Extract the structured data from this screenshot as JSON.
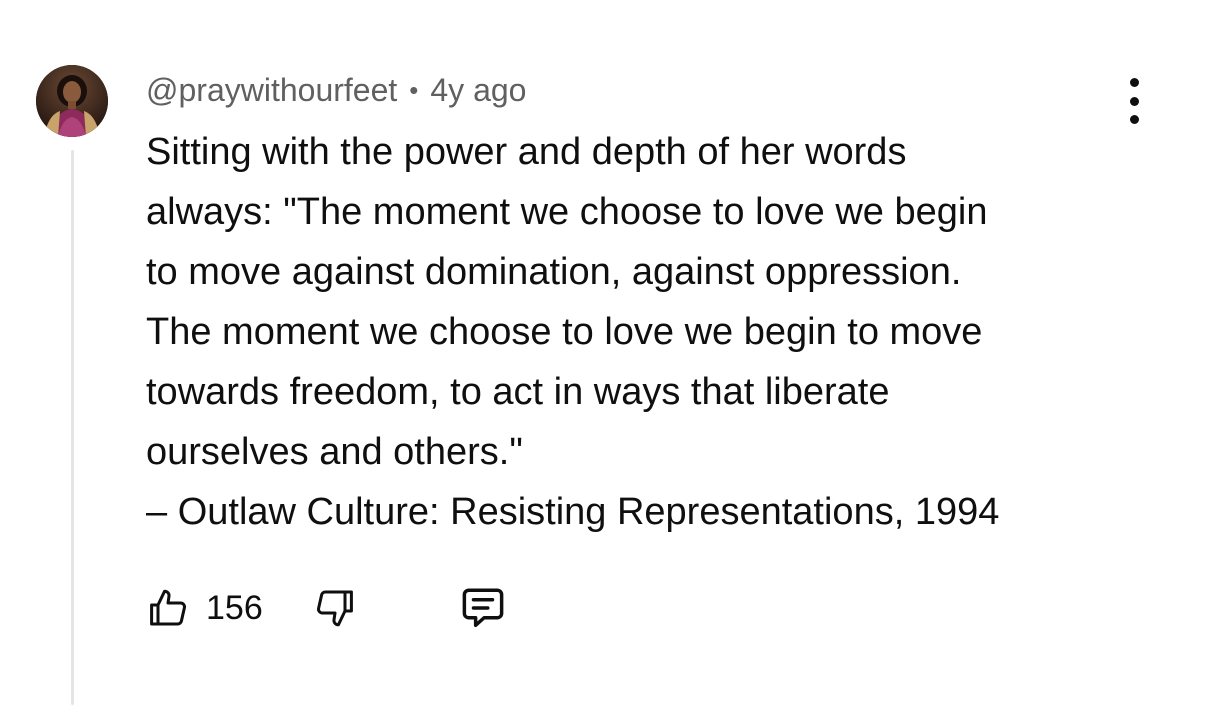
{
  "comment": {
    "handle": "@praywithourfeet",
    "separator": "•",
    "time_ago": "4y ago",
    "body_lines": [
      "Sitting with the power and depth of her words",
      "always: \"The moment we choose to love we begin",
      "to move against domination, against oppression.",
      "The moment we choose to love we begin to move",
      "towards freedom, to act in ways that liberate",
      "ourselves and others.\"",
      "– Outlaw Culture: Resisting Representations, 1994"
    ],
    "like_count": "156"
  },
  "icons": {
    "more": "more-vertical-icon",
    "like": "thumbs-up-icon",
    "dislike": "thumbs-down-icon",
    "reply": "comment-reply-icon"
  },
  "colors": {
    "text": "#0f0f0f",
    "meta": "#606060",
    "thread_line": "#e5e5e5",
    "background": "#ffffff"
  }
}
